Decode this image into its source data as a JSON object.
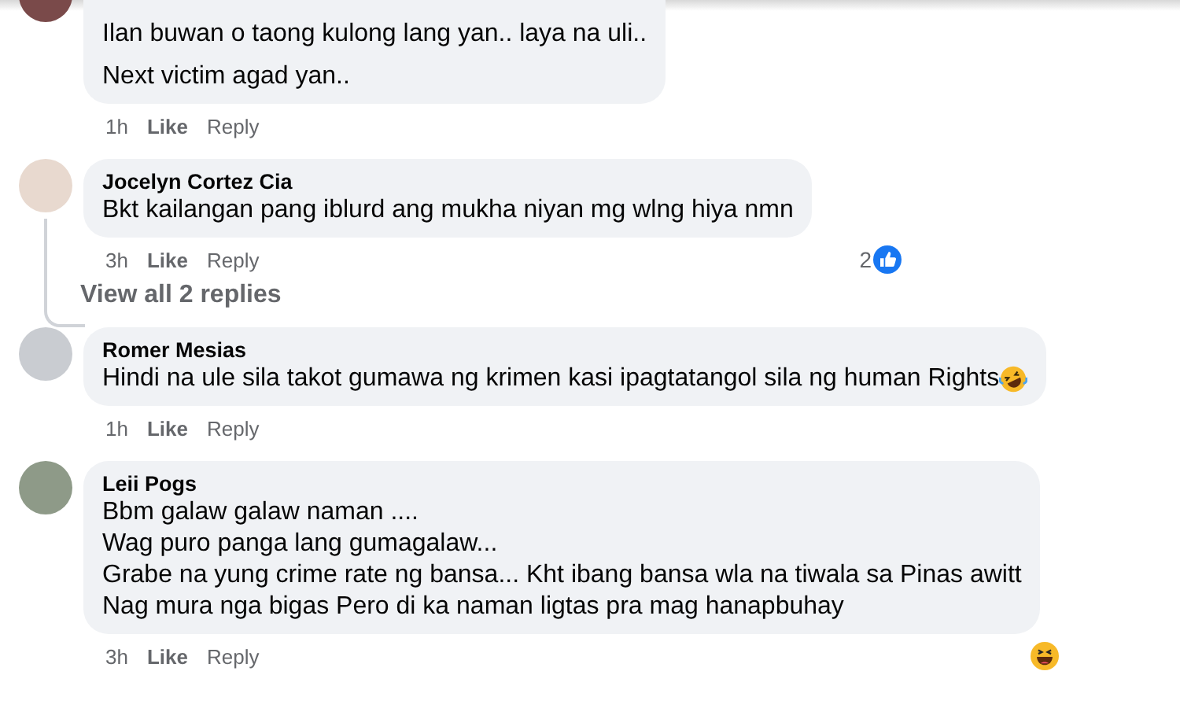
{
  "comments": [
    {
      "lines": [
        "Ilan buwan o taong kulong lang yan.. laya na uli..",
        "Next victim agad yan.."
      ],
      "time": "1h",
      "actions": [
        "Like",
        "Reply"
      ],
      "cut_top": true
    },
    {
      "author": "Jocelyn Cortez Cia",
      "lines": [
        "Bkt kailangan pang iblurd ang mukha niyan mg wlng hiya nmn"
      ],
      "time": "3h",
      "actions": [
        "Like",
        "Reply"
      ],
      "reaction": {
        "kind": "like",
        "count": "2"
      },
      "view_replies": "View all 2 replies"
    },
    {
      "author": "Romer Mesias",
      "lines": [
        "Hindi na ule sila takot gumawa ng krimen kasi ipagtatangol sila ng human Rights"
      ],
      "trailing_emoji": true,
      "time": "1h",
      "actions": [
        "Like",
        "Reply"
      ]
    },
    {
      "author": "Leii Pogs",
      "lines": [
        "Bbm galaw galaw naman ....",
        "Wag puro panga lang gumagalaw...",
        "Grabe na yung crime rate ng bansa... Kht ibang bansa wla na tiwala sa Pinas awitt",
        "Nag mura nga bigas Pero di ka naman ligtas pra mag hanapbuhay"
      ],
      "time": "3h",
      "actions": [
        "Like",
        "Reply"
      ],
      "reaction": {
        "kind": "haha"
      }
    }
  ]
}
